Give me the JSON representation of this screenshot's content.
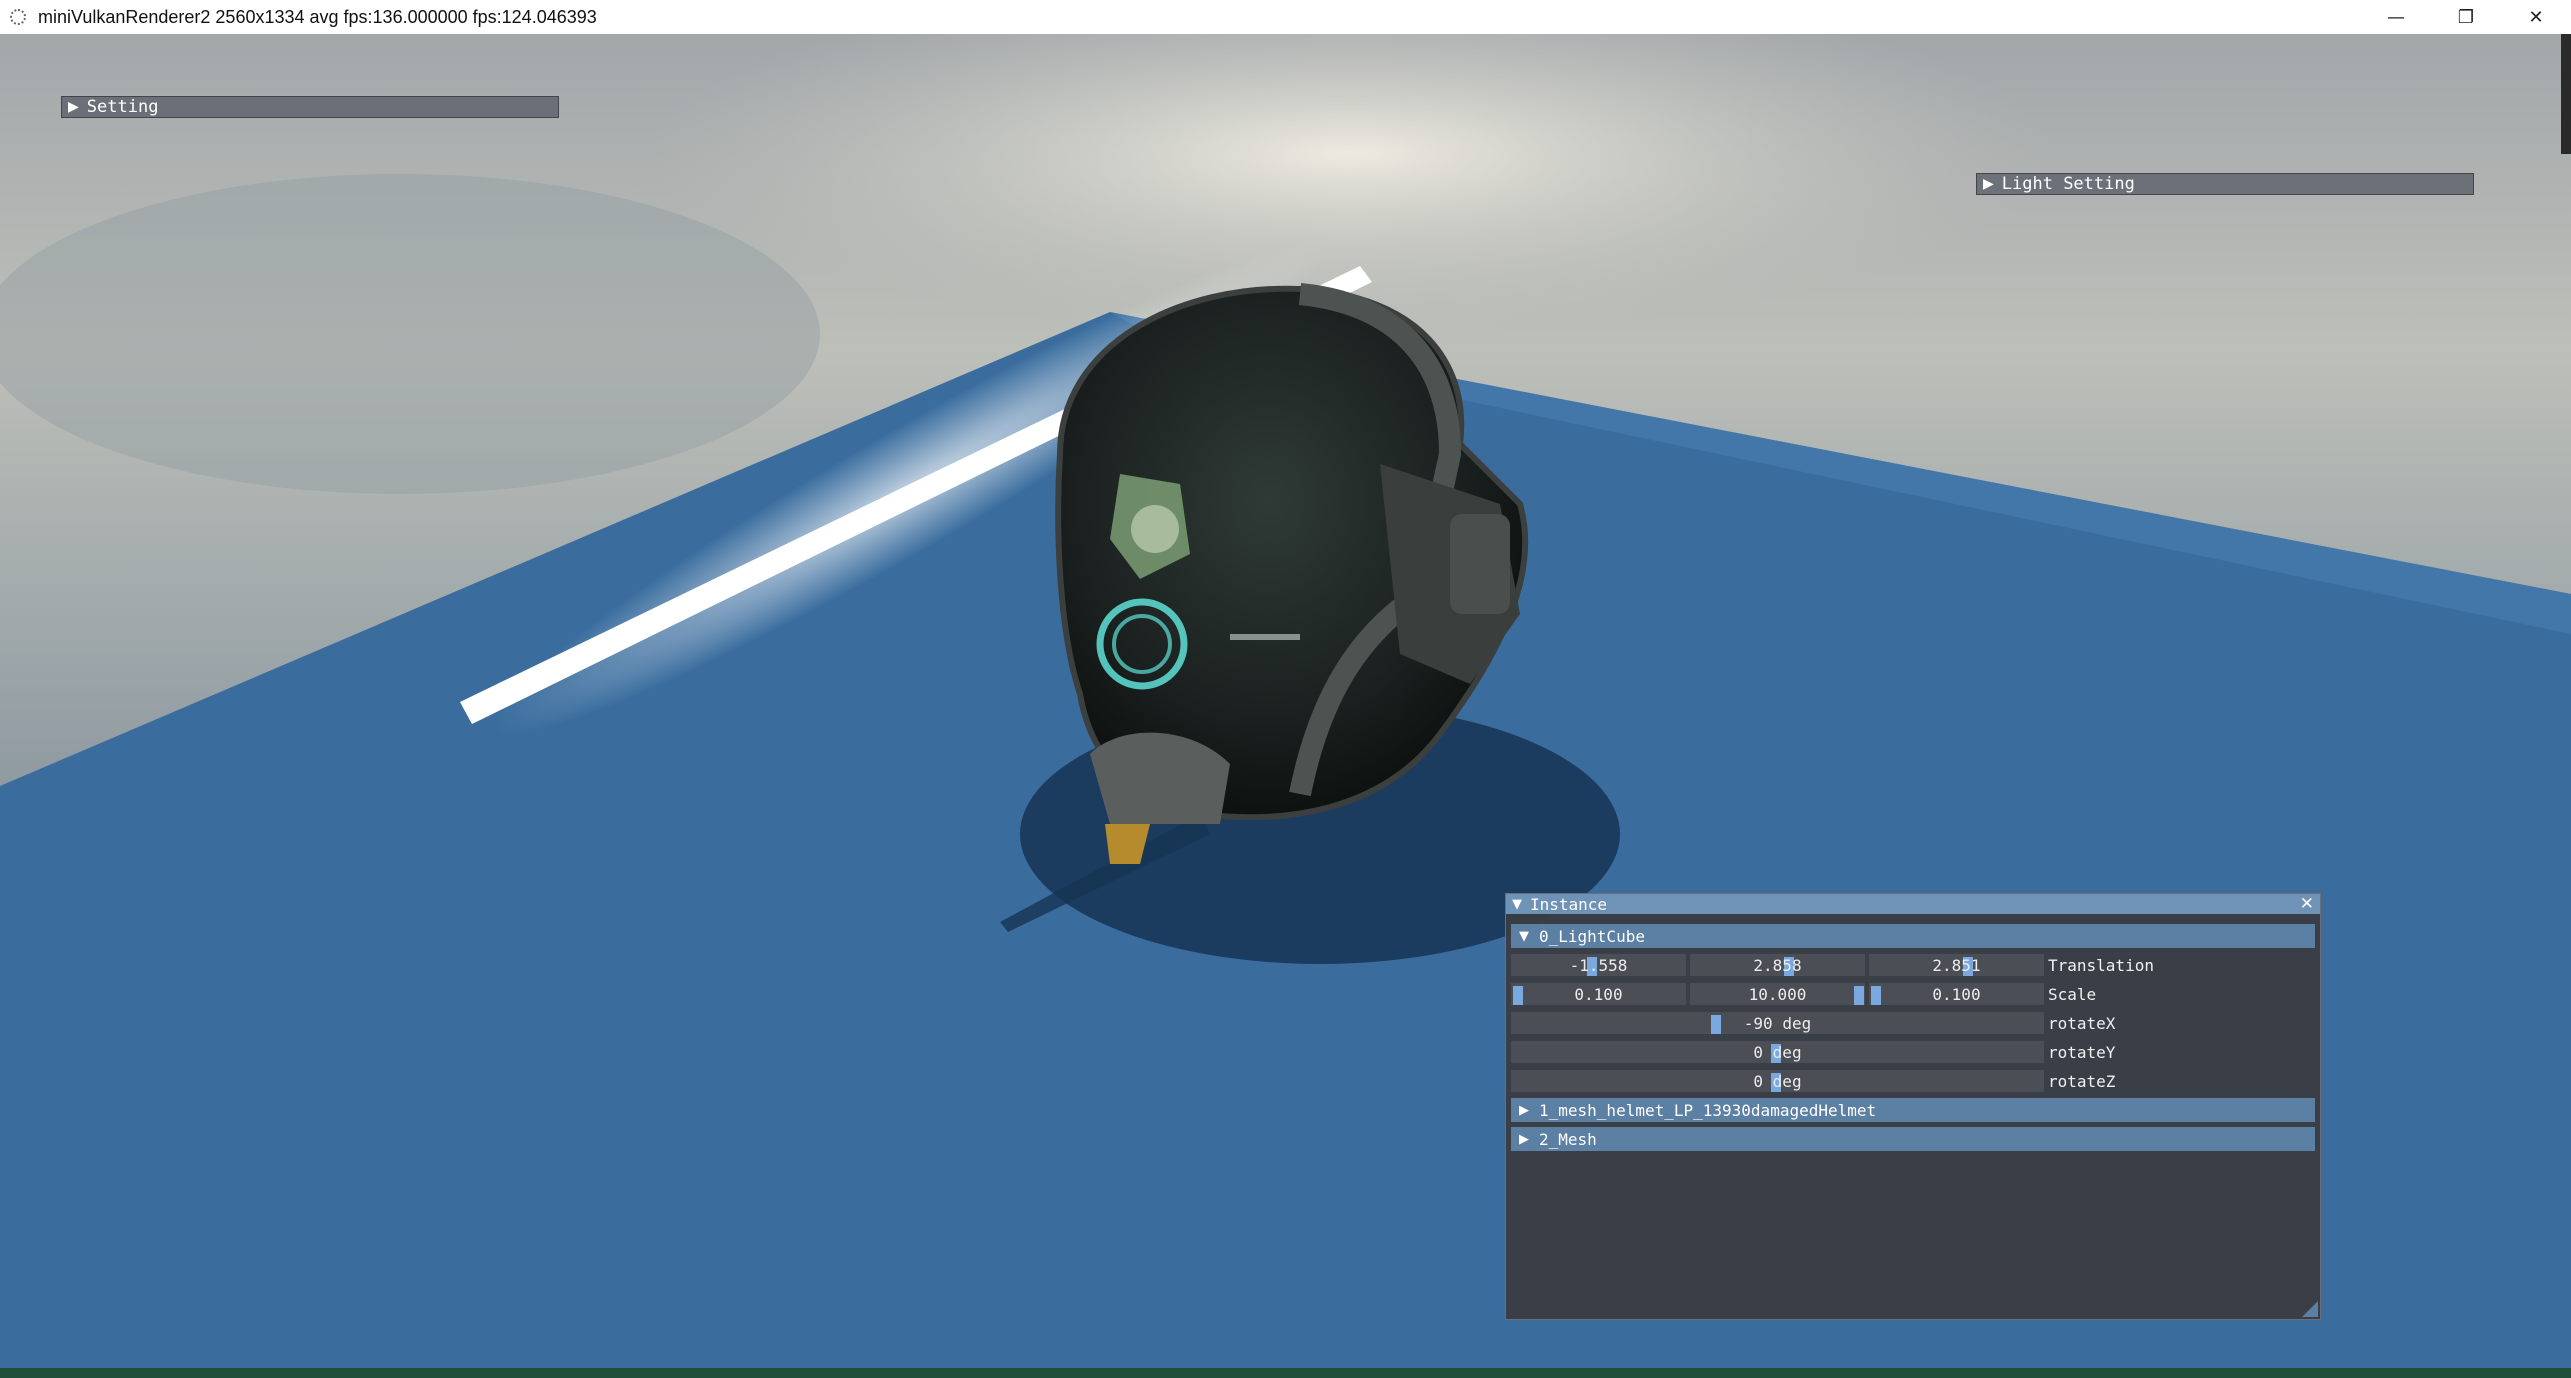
{
  "window": {
    "title": "miniVulkanRenderer2 2560x1334 avg fps:136.000000 fps:124.046393",
    "minimize_glyph": "—",
    "maximize_glyph": "❐",
    "close_glyph": "✕"
  },
  "setting_panel": {
    "label": "Setting",
    "expanded": false
  },
  "light_setting_panel": {
    "label": "Light Setting",
    "expanded": false
  },
  "instance_panel": {
    "title": "Instance",
    "close_glyph": "✕",
    "items": [
      {
        "label": "0_LightCube",
        "expanded": true,
        "translation": {
          "x": "-1.558",
          "y": "2.858",
          "z": "2.851",
          "label": "Translation"
        },
        "scale": {
          "x": "0.100",
          "y": "10.000",
          "z": "0.100",
          "label": "Scale"
        },
        "rotateX": {
          "value": "-90 deg",
          "label": "rotateX"
        },
        "rotateY": {
          "value": "0 deg",
          "label": "rotateY"
        },
        "rotateZ": {
          "value": "0 deg",
          "label": "rotateZ"
        }
      },
      {
        "label": "1_mesh_helmet_LP_13930damagedHelmet",
        "expanded": false
      },
      {
        "label": "2_Mesh",
        "expanded": false
      }
    ]
  },
  "icons": {
    "expanded": "expanded-triangle-icon",
    "collapsed": "collapsed-triangle-icon"
  },
  "colors": {
    "ground": "#3a6d9e",
    "header": "#5c7fa4",
    "panel_title": "#6f92b7",
    "slider_grab": "#7fb2ee"
  }
}
